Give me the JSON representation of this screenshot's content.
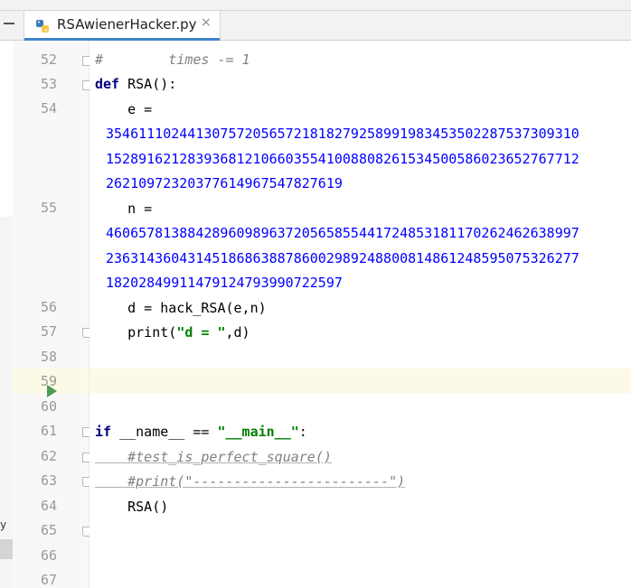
{
  "tab": {
    "title": "RSAwienerHacker.py",
    "close": "×"
  },
  "left_panel": {
    "fragment": "y"
  },
  "gutter_lines": [
    "52",
    "53",
    "54",
    "55",
    "56",
    "57",
    "58",
    "59",
    "60",
    "61",
    "62",
    "63",
    "64",
    "65",
    "66",
    "67"
  ],
  "code": {
    "l52": "#        times -= 1",
    "l53_kw": "def",
    "l53_rest": " RSA():",
    "l54_a": "    e =",
    "l54_b": "3546111024413075720565721818279258991983453502287537309310",
    "l54_c": "1528916212839368121066035541008808261534500586023652767712",
    "l54_d": "262109723203776149675478276​19",
    "l55_a": "    n =",
    "l55_b": "4606578138842896098963720565855441724853181170262462638997",
    "l55_c": "2363143604314518686388786002989248800814861248595075326277",
    "l55_d": "18202849911479124793990722597",
    "l56": "    d = hack_RSA(e,n)",
    "l57_a": "    print(",
    "l57_str": "\"d = \"",
    "l57_b": ",d)",
    "l61_kw": "if",
    "l61_a": " __name__ == ",
    "l61_str": "\"__main__\"",
    "l61_b": ":",
    "l62": "    #test_is_perfect_square()",
    "l63": "    #print(\"------------------------\")",
    "l64": "    RSA()"
  }
}
